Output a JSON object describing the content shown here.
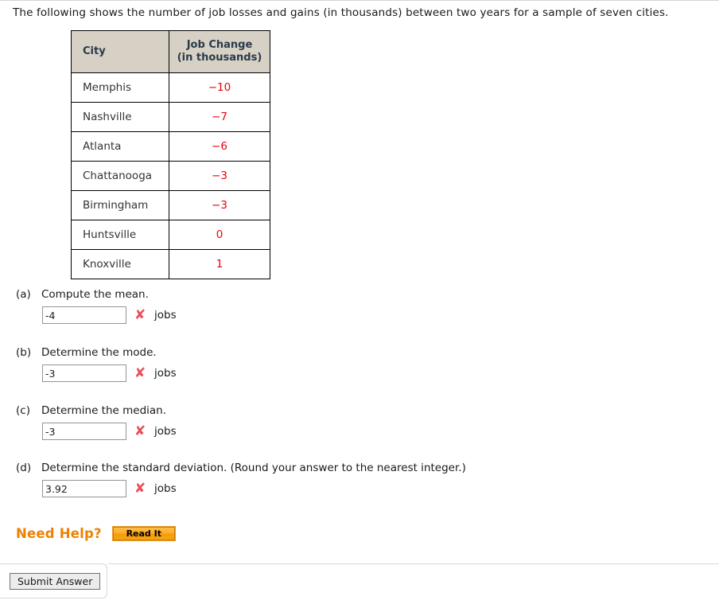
{
  "intro": {
    "text": "The following shows the number of job losses and gains (in thousands) between two years for a sample of seven cities."
  },
  "table": {
    "headers": {
      "city": "City",
      "value_line1": "Job Change",
      "value_line2": "(in thousands)"
    },
    "rows": [
      {
        "city": "Memphis",
        "value": "−10"
      },
      {
        "city": "Nashville",
        "value": "−7"
      },
      {
        "city": "Atlanta",
        "value": "−6"
      },
      {
        "city": "Chattanooga",
        "value": "−3"
      },
      {
        "city": "Birmingham",
        "value": "−3"
      },
      {
        "city": "Huntsville",
        "value": "0"
      },
      {
        "city": "Knoxville",
        "value": "1"
      }
    ]
  },
  "parts": [
    {
      "letter": "(a)",
      "prompt": "Compute the mean.",
      "value": "-4",
      "status_icon": "wrong-x-icon",
      "status_glyph": "✘",
      "unit": "jobs"
    },
    {
      "letter": "(b)",
      "prompt": "Determine the mode.",
      "value": "-3",
      "status_icon": "wrong-x-icon",
      "status_glyph": "✘",
      "unit": "jobs"
    },
    {
      "letter": "(c)",
      "prompt": "Determine the median.",
      "value": "-3",
      "status_icon": "wrong-x-icon",
      "status_glyph": "✘",
      "unit": "jobs"
    },
    {
      "letter": "(d)",
      "prompt": "Determine the standard deviation. (Round your answer to the nearest integer.)",
      "value": "3.92",
      "status_icon": "wrong-x-icon",
      "status_glyph": "✘",
      "unit": "jobs"
    }
  ],
  "help": {
    "label": "Need Help?",
    "read_it_label": "Read It"
  },
  "submit": {
    "label": "Submit Answer"
  },
  "colors": {
    "value_red": "#e8000b",
    "wrong_mark": "#e8505b",
    "header_bg": "#d6d1c4",
    "header_text": "#2b3a4a",
    "help_orange": "#f08000"
  }
}
